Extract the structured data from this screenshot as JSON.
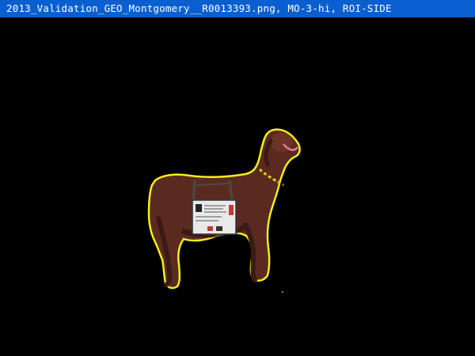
{
  "window": {
    "title": "2013_Validation_GEO_Montgomery__R0013393.png, MO-3-hi, ROI-SIDE"
  },
  "colors": {
    "titlebar": "#0a5fd0",
    "background": "#000000",
    "roi_outline": "#f2ee1c",
    "goat_body": "#5a2a20",
    "goat_shadow": "#2e1410",
    "tag_card": "#e9e9e9"
  },
  "image": {
    "subject": "goat",
    "roi_label_icon": "roi-outline"
  }
}
